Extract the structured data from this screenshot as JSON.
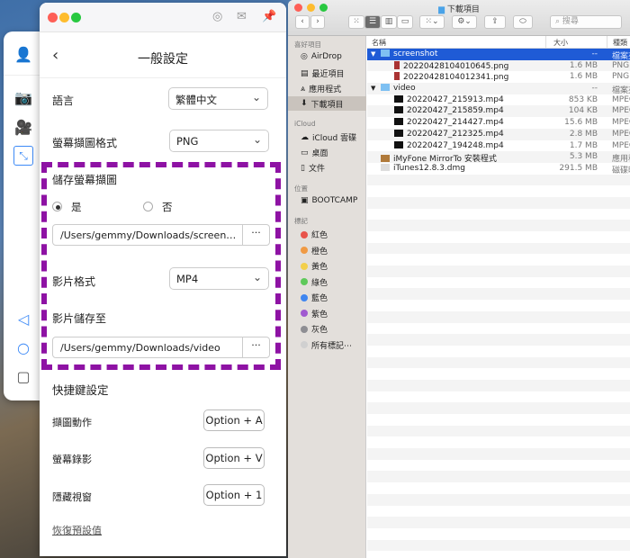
{
  "settings": {
    "title": "一般設定",
    "language_label": "語言",
    "language_value": "繁體中文",
    "screenshot_format_label": "螢幕擷圖格式",
    "screenshot_format_value": "PNG",
    "save_screenshot_label": "儲存螢幕擷圖",
    "yes": "是",
    "no": "否",
    "screenshot_path": "/Users/gemmy/Downloads/screenshot",
    "video_format_label": "影片格式",
    "video_format_value": "MP4",
    "video_save_label": "影片儲存至",
    "video_path": "/Users/gemmy/Downloads/video",
    "more": "···",
    "hotkey_title": "快捷鍵設定",
    "hotkeys": [
      {
        "label": "擷圖動作",
        "key": "Option + A"
      },
      {
        "label": "螢幕錄影",
        "key": "Option + V"
      },
      {
        "label": "隱藏視窗",
        "key": "Option + 1"
      }
    ],
    "reset": "恢復預設值"
  },
  "finder": {
    "title": "下載項目",
    "search_placeholder": "搜尋",
    "sidebar": {
      "favorites": "喜好項目",
      "fav_items": [
        "AirDrop",
        "最近項目",
        "應用程式",
        "下載項目"
      ],
      "icloud": "iCloud",
      "icloud_items": [
        "iCloud 雲碟",
        "桌面",
        "文件"
      ],
      "locations": "位置",
      "loc_items": [
        "BOOTCAMP"
      ],
      "tags": "標記",
      "tag_items": [
        {
          "name": "紅色",
          "color": "#e8534a"
        },
        {
          "name": "橙色",
          "color": "#f09a44"
        },
        {
          "name": "黃色",
          "color": "#f3cf4a"
        },
        {
          "name": "綠色",
          "color": "#5ec95a"
        },
        {
          "name": "藍色",
          "color": "#3f86f0"
        },
        {
          "name": "紫色",
          "color": "#a05ad0"
        },
        {
          "name": "灰色",
          "color": "#8e8e93"
        },
        {
          "name": "所有標記⋯",
          "color": "#d0d0d0"
        }
      ]
    },
    "columns": {
      "name": "名稱",
      "size": "大小",
      "kind": "種類"
    },
    "rows": [
      {
        "name": "screenshot",
        "size": "--",
        "kind": "檔案夾",
        "type": "folder",
        "level": 0,
        "sel": true
      },
      {
        "name": "20220428104010645.png",
        "size": "1.6 MB",
        "kind": "PNG",
        "type": "png",
        "level": 1
      },
      {
        "name": "20220428104012341.png",
        "size": "1.6 MB",
        "kind": "PNG",
        "type": "png",
        "level": 1
      },
      {
        "name": "video",
        "size": "--",
        "kind": "檔案夾",
        "type": "folder",
        "level": 0
      },
      {
        "name": "20220427_215913.mp4",
        "size": "853 KB",
        "kind": "MPEG",
        "type": "mp4",
        "level": 1
      },
      {
        "name": "20220427_215859.mp4",
        "size": "104 KB",
        "kind": "MPEG",
        "type": "mp4",
        "level": 1
      },
      {
        "name": "20220427_214427.mp4",
        "size": "15.6 MB",
        "kind": "MPEG",
        "type": "mp4",
        "level": 1
      },
      {
        "name": "20220427_212325.mp4",
        "size": "2.8 MB",
        "kind": "MPEG",
        "type": "mp4",
        "level": 1
      },
      {
        "name": "20220427_194248.mp4",
        "size": "1.7 MB",
        "kind": "MPEG",
        "type": "mp4",
        "level": 1
      },
      {
        "name": "iMyFone MirrorTo 安裝程式",
        "size": "5.3 MB",
        "kind": "應用程",
        "type": "app",
        "level": 0
      },
      {
        "name": "iTunes12.8.3.dmg",
        "size": "291.5 MB",
        "kind": "磁碟映",
        "type": "dmg",
        "level": 0
      }
    ]
  }
}
